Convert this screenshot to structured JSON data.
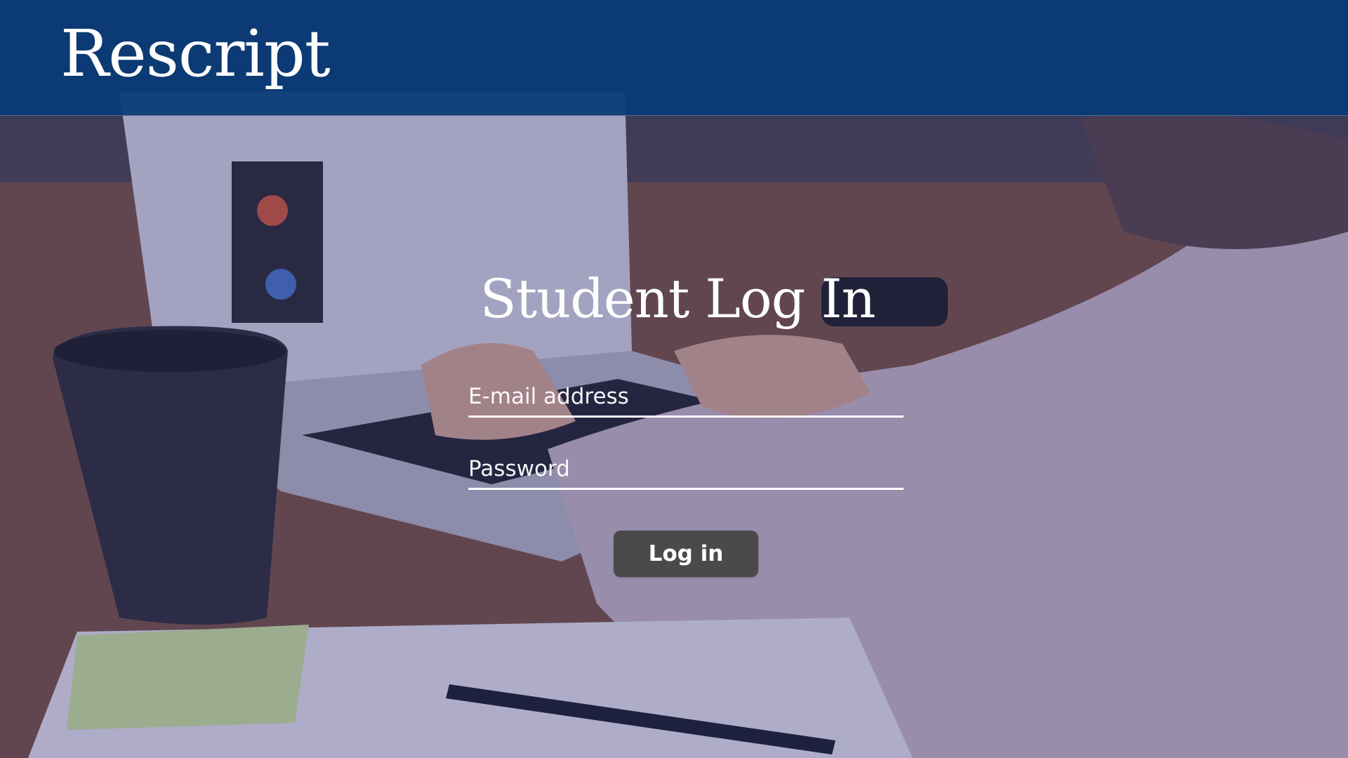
{
  "header": {
    "brand": "Rescript"
  },
  "login": {
    "title": "Student Log In",
    "email_placeholder": "E-mail address",
    "password_placeholder": "Password",
    "submit_label": "Log in"
  },
  "colors": {
    "header_bg": "#0a3a76",
    "button_bg": "#4a4a4c",
    "text": "#ffffff"
  }
}
